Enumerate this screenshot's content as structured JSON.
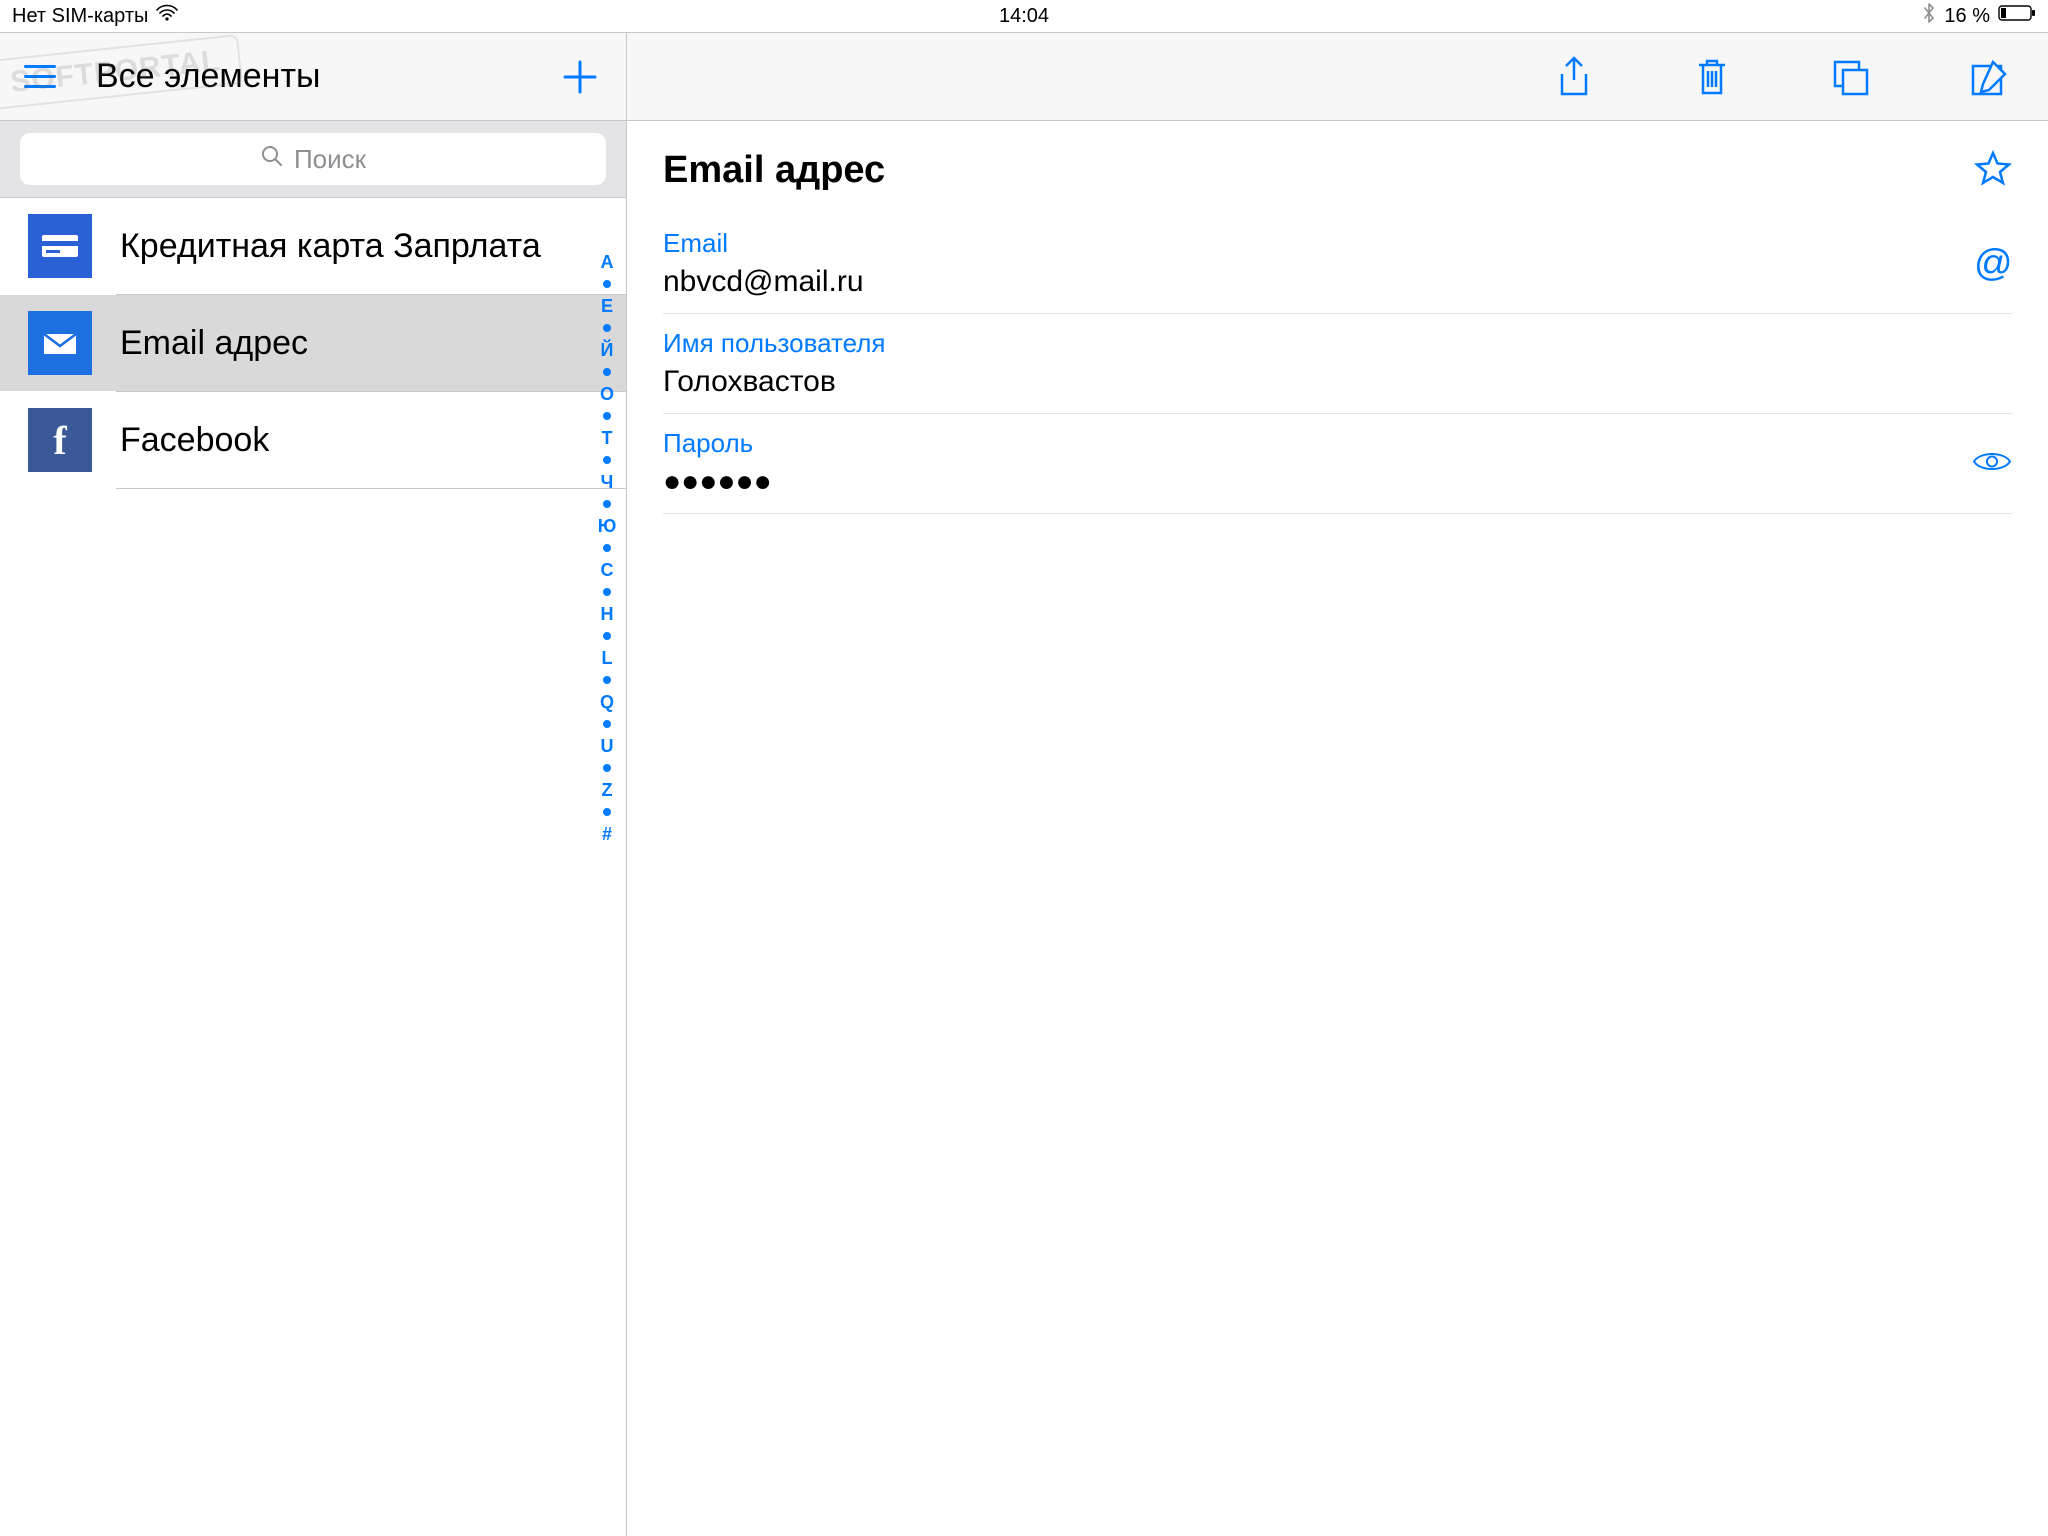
{
  "status": {
    "carrier": "Нет SIM-карты",
    "time": "14:04",
    "battery_pct": "16 %"
  },
  "sidebar": {
    "title": "Все элементы",
    "search_placeholder": "Поиск",
    "items": [
      {
        "label": "Кредитная карта Запрлата",
        "type": "card",
        "selected": false
      },
      {
        "label": "Email адрес",
        "type": "mail",
        "selected": true
      },
      {
        "label": "Facebook",
        "type": "fb",
        "selected": false
      }
    ],
    "index_letters": [
      "А",
      "Е",
      "Й",
      "О",
      "Т",
      "Ч",
      "Ю",
      "C",
      "H",
      "L",
      "Q",
      "U",
      "Z",
      "#"
    ]
  },
  "detail": {
    "title": "Email адрес",
    "fields": [
      {
        "label": "Email",
        "value": "nbvcd@mail.ru",
        "trail": "at"
      },
      {
        "label": "Имя пользователя",
        "value": "Голохвастов",
        "trail": ""
      },
      {
        "label": "Пароль",
        "value": "●●●●●●",
        "trail": "eye"
      }
    ]
  },
  "watermark": "SOFTPORTAL"
}
